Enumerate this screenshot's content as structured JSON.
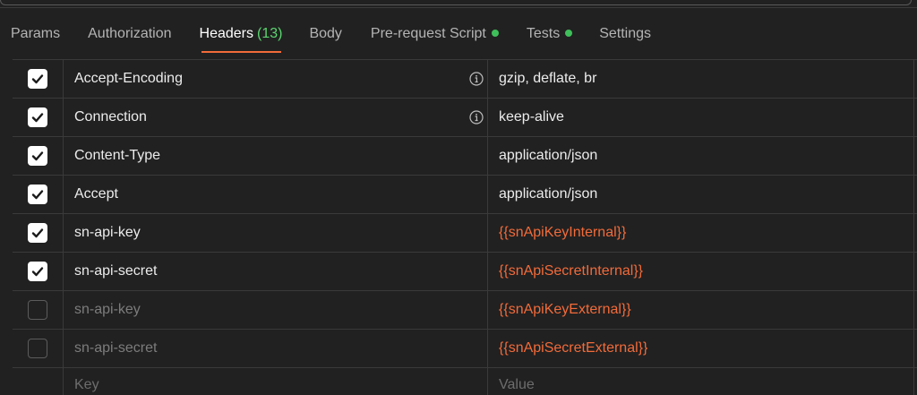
{
  "tabs": [
    {
      "label": "Params",
      "active": false
    },
    {
      "label": "Authorization",
      "active": false
    },
    {
      "label": "Headers",
      "count": "(13)",
      "active": true
    },
    {
      "label": "Body",
      "active": false
    },
    {
      "label": "Pre-request Script",
      "dot": true,
      "active": false
    },
    {
      "label": "Tests",
      "dot": true,
      "active": false
    },
    {
      "label": "Settings",
      "active": false
    }
  ],
  "headers": [
    {
      "checked": true,
      "key": "Accept-Encoding",
      "info": true,
      "value": "gzip, deflate, br",
      "is_var": false
    },
    {
      "checked": true,
      "key": "Connection",
      "info": true,
      "value": "keep-alive",
      "is_var": false
    },
    {
      "checked": true,
      "key": "Content-Type",
      "info": false,
      "value": "application/json",
      "is_var": false
    },
    {
      "checked": true,
      "key": "Accept",
      "info": false,
      "value": "application/json",
      "is_var": false
    },
    {
      "checked": true,
      "key": "sn-api-key",
      "info": false,
      "value": "{{snApiKeyInternal}}",
      "is_var": true
    },
    {
      "checked": true,
      "key": "sn-api-secret",
      "info": false,
      "value": "{{snApiSecretInternal}}",
      "is_var": true
    },
    {
      "checked": false,
      "key": "sn-api-key",
      "info": false,
      "value": "{{snApiKeyExternal}}",
      "is_var": true
    },
    {
      "checked": false,
      "key": "sn-api-secret",
      "info": false,
      "value": "{{snApiSecretExternal}}",
      "is_var": true
    }
  ],
  "new_row": {
    "key_placeholder": "Key",
    "value_placeholder": "Value"
  },
  "colors": {
    "accent": "#f26b3a",
    "status_dot": "#3fbf5a",
    "count": "#5bd66f"
  }
}
